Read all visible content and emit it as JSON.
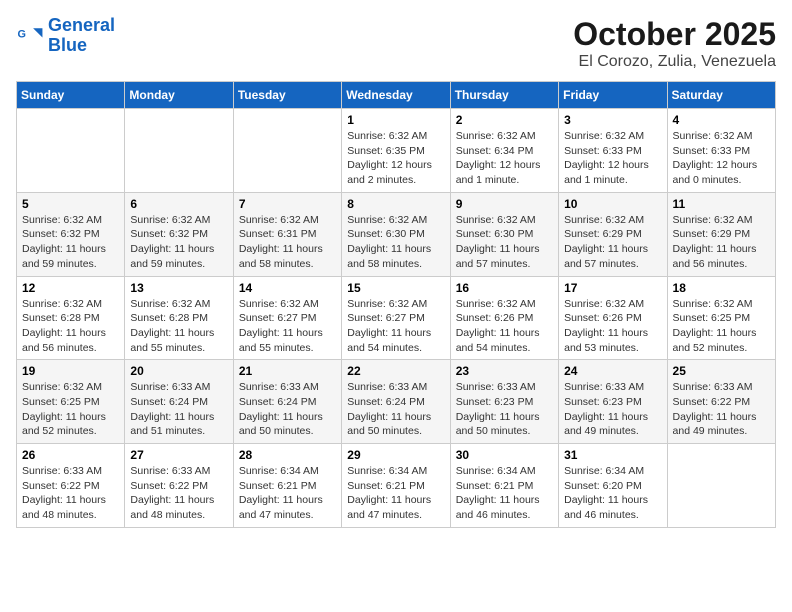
{
  "header": {
    "logo_line1": "General",
    "logo_line2": "Blue",
    "month": "October 2025",
    "location": "El Corozo, Zulia, Venezuela"
  },
  "weekdays": [
    "Sunday",
    "Monday",
    "Tuesday",
    "Wednesday",
    "Thursday",
    "Friday",
    "Saturday"
  ],
  "weeks": [
    [
      {
        "day": "",
        "info": ""
      },
      {
        "day": "",
        "info": ""
      },
      {
        "day": "",
        "info": ""
      },
      {
        "day": "1",
        "info": "Sunrise: 6:32 AM\nSunset: 6:35 PM\nDaylight: 12 hours\nand 2 minutes."
      },
      {
        "day": "2",
        "info": "Sunrise: 6:32 AM\nSunset: 6:34 PM\nDaylight: 12 hours\nand 1 minute."
      },
      {
        "day": "3",
        "info": "Sunrise: 6:32 AM\nSunset: 6:33 PM\nDaylight: 12 hours\nand 1 minute."
      },
      {
        "day": "4",
        "info": "Sunrise: 6:32 AM\nSunset: 6:33 PM\nDaylight: 12 hours\nand 0 minutes."
      }
    ],
    [
      {
        "day": "5",
        "info": "Sunrise: 6:32 AM\nSunset: 6:32 PM\nDaylight: 11 hours\nand 59 minutes."
      },
      {
        "day": "6",
        "info": "Sunrise: 6:32 AM\nSunset: 6:32 PM\nDaylight: 11 hours\nand 59 minutes."
      },
      {
        "day": "7",
        "info": "Sunrise: 6:32 AM\nSunset: 6:31 PM\nDaylight: 11 hours\nand 58 minutes."
      },
      {
        "day": "8",
        "info": "Sunrise: 6:32 AM\nSunset: 6:30 PM\nDaylight: 11 hours\nand 58 minutes."
      },
      {
        "day": "9",
        "info": "Sunrise: 6:32 AM\nSunset: 6:30 PM\nDaylight: 11 hours\nand 57 minutes."
      },
      {
        "day": "10",
        "info": "Sunrise: 6:32 AM\nSunset: 6:29 PM\nDaylight: 11 hours\nand 57 minutes."
      },
      {
        "day": "11",
        "info": "Sunrise: 6:32 AM\nSunset: 6:29 PM\nDaylight: 11 hours\nand 56 minutes."
      }
    ],
    [
      {
        "day": "12",
        "info": "Sunrise: 6:32 AM\nSunset: 6:28 PM\nDaylight: 11 hours\nand 56 minutes."
      },
      {
        "day": "13",
        "info": "Sunrise: 6:32 AM\nSunset: 6:28 PM\nDaylight: 11 hours\nand 55 minutes."
      },
      {
        "day": "14",
        "info": "Sunrise: 6:32 AM\nSunset: 6:27 PM\nDaylight: 11 hours\nand 55 minutes."
      },
      {
        "day": "15",
        "info": "Sunrise: 6:32 AM\nSunset: 6:27 PM\nDaylight: 11 hours\nand 54 minutes."
      },
      {
        "day": "16",
        "info": "Sunrise: 6:32 AM\nSunset: 6:26 PM\nDaylight: 11 hours\nand 54 minutes."
      },
      {
        "day": "17",
        "info": "Sunrise: 6:32 AM\nSunset: 6:26 PM\nDaylight: 11 hours\nand 53 minutes."
      },
      {
        "day": "18",
        "info": "Sunrise: 6:32 AM\nSunset: 6:25 PM\nDaylight: 11 hours\nand 52 minutes."
      }
    ],
    [
      {
        "day": "19",
        "info": "Sunrise: 6:32 AM\nSunset: 6:25 PM\nDaylight: 11 hours\nand 52 minutes."
      },
      {
        "day": "20",
        "info": "Sunrise: 6:33 AM\nSunset: 6:24 PM\nDaylight: 11 hours\nand 51 minutes."
      },
      {
        "day": "21",
        "info": "Sunrise: 6:33 AM\nSunset: 6:24 PM\nDaylight: 11 hours\nand 50 minutes."
      },
      {
        "day": "22",
        "info": "Sunrise: 6:33 AM\nSunset: 6:24 PM\nDaylight: 11 hours\nand 50 minutes."
      },
      {
        "day": "23",
        "info": "Sunrise: 6:33 AM\nSunset: 6:23 PM\nDaylight: 11 hours\nand 50 minutes."
      },
      {
        "day": "24",
        "info": "Sunrise: 6:33 AM\nSunset: 6:23 PM\nDaylight: 11 hours\nand 49 minutes."
      },
      {
        "day": "25",
        "info": "Sunrise: 6:33 AM\nSunset: 6:22 PM\nDaylight: 11 hours\nand 49 minutes."
      }
    ],
    [
      {
        "day": "26",
        "info": "Sunrise: 6:33 AM\nSunset: 6:22 PM\nDaylight: 11 hours\nand 48 minutes."
      },
      {
        "day": "27",
        "info": "Sunrise: 6:33 AM\nSunset: 6:22 PM\nDaylight: 11 hours\nand 48 minutes."
      },
      {
        "day": "28",
        "info": "Sunrise: 6:34 AM\nSunset: 6:21 PM\nDaylight: 11 hours\nand 47 minutes."
      },
      {
        "day": "29",
        "info": "Sunrise: 6:34 AM\nSunset: 6:21 PM\nDaylight: 11 hours\nand 47 minutes."
      },
      {
        "day": "30",
        "info": "Sunrise: 6:34 AM\nSunset: 6:21 PM\nDaylight: 11 hours\nand 46 minutes."
      },
      {
        "day": "31",
        "info": "Sunrise: 6:34 AM\nSunset: 6:20 PM\nDaylight: 11 hours\nand 46 minutes."
      },
      {
        "day": "",
        "info": ""
      }
    ]
  ]
}
